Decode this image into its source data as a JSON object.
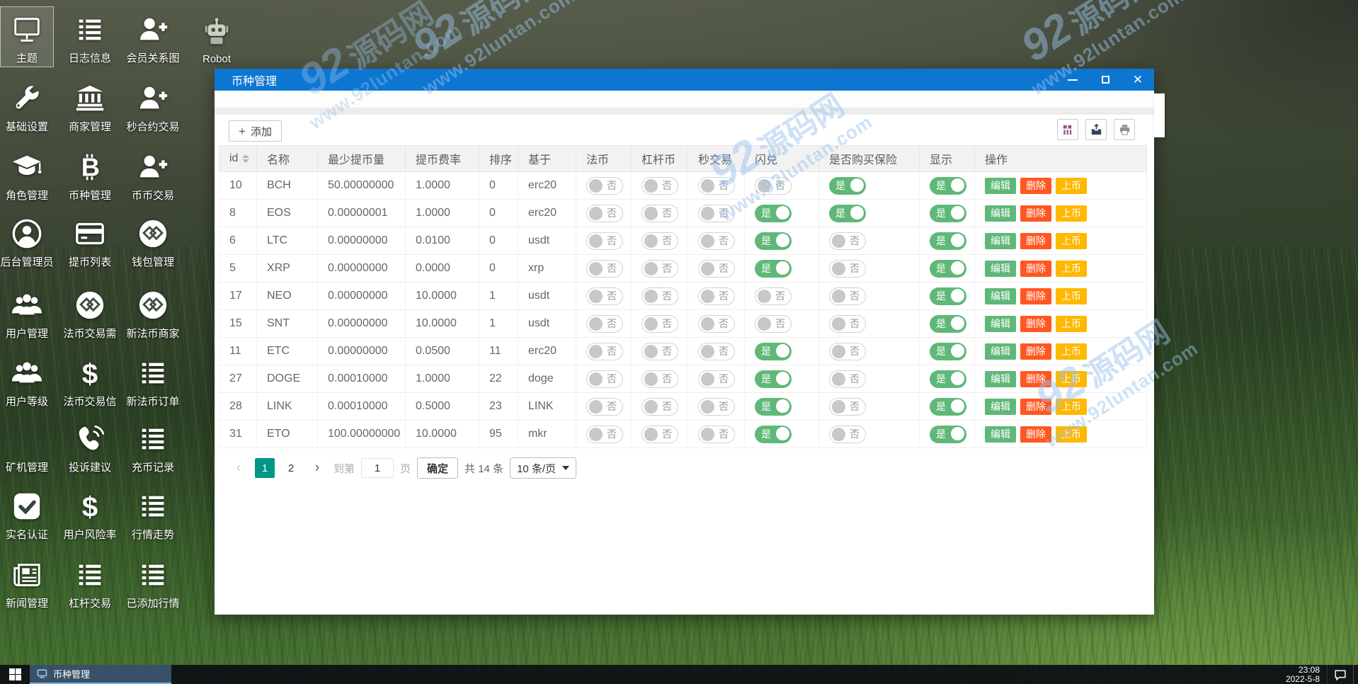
{
  "desktop": {
    "icons": [
      {
        "label": "主题",
        "icon": "monitor-icon",
        "col": 0,
        "row": 0,
        "selected": true
      },
      {
        "label": "日志信息",
        "icon": "list-icon",
        "col": 1,
        "row": 0
      },
      {
        "label": "会员关系图",
        "icon": "user-plus-icon",
        "col": 2,
        "row": 0
      },
      {
        "label": "Robot",
        "icon": "robot-icon",
        "col": 3,
        "row": 0
      },
      {
        "label": "基础设置",
        "icon": "wrench-icon",
        "col": 0,
        "row": 1
      },
      {
        "label": "商家管理",
        "icon": "bank-icon",
        "col": 1,
        "row": 1
      },
      {
        "label": "秒合约交易",
        "icon": "user-plus-icon",
        "col": 2,
        "row": 1
      },
      {
        "label": "角色管理",
        "icon": "graduation-cap-icon",
        "col": 0,
        "row": 2
      },
      {
        "label": "币种管理",
        "icon": "bitcoin-icon",
        "col": 1,
        "row": 2
      },
      {
        "label": "币币交易",
        "icon": "user-plus-icon",
        "col": 2,
        "row": 2
      },
      {
        "label": "后台管理员",
        "icon": "user-circle-icon",
        "col": 0,
        "row": 3
      },
      {
        "label": "提币列表",
        "icon": "credit-card-icon",
        "col": 1,
        "row": 3
      },
      {
        "label": "钱包管理",
        "icon": "gem-circle-icon",
        "col": 2,
        "row": 3
      },
      {
        "label": "用户管理",
        "icon": "users-icon",
        "col": 0,
        "row": 4
      },
      {
        "label": "法币交易需",
        "icon": "gem-circle-icon",
        "col": 1,
        "row": 4
      },
      {
        "label": "新法币商家",
        "icon": "gem-circle-icon",
        "col": 2,
        "row": 4
      },
      {
        "label": "用户等级",
        "icon": "users-icon",
        "col": 0,
        "row": 5
      },
      {
        "label": "法币交易信",
        "icon": "dollar-icon",
        "col": 1,
        "row": 5
      },
      {
        "label": "新法币订单",
        "icon": "list-icon",
        "col": 2,
        "row": 5
      },
      {
        "label": "矿机管理",
        "icon": "none",
        "col": 0,
        "row": 6
      },
      {
        "label": "投诉建议",
        "icon": "phone-icon",
        "col": 1,
        "row": 6
      },
      {
        "label": "充币记录",
        "icon": "list-icon",
        "col": 2,
        "row": 6
      },
      {
        "label": "实名认证",
        "icon": "check-square-icon",
        "col": 0,
        "row": 7
      },
      {
        "label": "用户风险率",
        "icon": "dollar-icon",
        "col": 1,
        "row": 7
      },
      {
        "label": "行情走势",
        "icon": "list-icon",
        "col": 2,
        "row": 7
      },
      {
        "label": "新闻管理",
        "icon": "newspaper-icon",
        "col": 0,
        "row": 8
      },
      {
        "label": "杠杆交易",
        "icon": "list-icon",
        "col": 1,
        "row": 8
      },
      {
        "label": "已添加行情",
        "icon": "list-icon",
        "col": 2,
        "row": 8
      }
    ]
  },
  "window": {
    "title": "币种管理",
    "add_label": "添加",
    "add_plus": "+",
    "table": {
      "headers": [
        "id",
        "名称",
        "最少提币量",
        "提币费率",
        "排序",
        "基于",
        "法币",
        "杠杆币",
        "秒交易",
        "闪兑",
        "是否购买保险",
        "显示",
        "操作"
      ],
      "toggle_on_label": "是",
      "toggle_off_label": "否",
      "actions": [
        "编辑",
        "删除",
        "上币"
      ],
      "rows": [
        {
          "id": "10",
          "name": "BCH",
          "min_withdraw": "50.00000000",
          "fee": "1.0000",
          "sort": "0",
          "base": "erc20",
          "fiat": false,
          "lever": false,
          "seconds": false,
          "flash": false,
          "insurance": true,
          "show": true
        },
        {
          "id": "8",
          "name": "EOS",
          "min_withdraw": "0.00000001",
          "fee": "1.0000",
          "sort": "0",
          "base": "erc20",
          "fiat": false,
          "lever": false,
          "seconds": false,
          "flash": true,
          "insurance": true,
          "show": true
        },
        {
          "id": "6",
          "name": "LTC",
          "min_withdraw": "0.00000000",
          "fee": "0.0100",
          "sort": "0",
          "base": "usdt",
          "fiat": false,
          "lever": false,
          "seconds": false,
          "flash": true,
          "insurance": false,
          "show": true
        },
        {
          "id": "5",
          "name": "XRP",
          "min_withdraw": "0.00000000",
          "fee": "0.0000",
          "sort": "0",
          "base": "xrp",
          "fiat": false,
          "lever": false,
          "seconds": false,
          "flash": true,
          "insurance": false,
          "show": true
        },
        {
          "id": "17",
          "name": "NEO",
          "min_withdraw": "0.00000000",
          "fee": "10.0000",
          "sort": "1",
          "base": "usdt",
          "fiat": false,
          "lever": false,
          "seconds": false,
          "flash": false,
          "insurance": false,
          "show": true
        },
        {
          "id": "15",
          "name": "SNT",
          "min_withdraw": "0.00000000",
          "fee": "10.0000",
          "sort": "1",
          "base": "usdt",
          "fiat": false,
          "lever": false,
          "seconds": false,
          "flash": false,
          "insurance": false,
          "show": true
        },
        {
          "id": "11",
          "name": "ETC",
          "min_withdraw": "0.00000000",
          "fee": "0.0500",
          "sort": "11",
          "base": "erc20",
          "fiat": false,
          "lever": false,
          "seconds": false,
          "flash": true,
          "insurance": false,
          "show": true
        },
        {
          "id": "27",
          "name": "DOGE",
          "min_withdraw": "0.00010000",
          "fee": "1.0000",
          "sort": "22",
          "base": "doge",
          "fiat": false,
          "lever": false,
          "seconds": false,
          "flash": true,
          "insurance": false,
          "show": true
        },
        {
          "id": "28",
          "name": "LINK",
          "min_withdraw": "0.00010000",
          "fee": "0.5000",
          "sort": "23",
          "base": "LINK",
          "fiat": false,
          "lever": false,
          "seconds": false,
          "flash": true,
          "insurance": false,
          "show": true
        },
        {
          "id": "31",
          "name": "ETO",
          "min_withdraw": "100.00000000",
          "fee": "10.0000",
          "sort": "95",
          "base": "mkr",
          "fiat": false,
          "lever": false,
          "seconds": false,
          "flash": true,
          "insurance": false,
          "show": true
        }
      ]
    },
    "pagination": {
      "prev": "‹",
      "pages": [
        "1",
        "2"
      ],
      "active_page": "1",
      "next": "›",
      "goto_label": "到第",
      "goto_value": "1",
      "page_label": "页",
      "confirm_label": "确定",
      "total_label": "共 14 条",
      "per_page_label": "10 条/页"
    }
  },
  "taskbar": {
    "task_label": "币种管理",
    "time": "23:08",
    "date": "2022-5-8"
  },
  "watermark": {
    "logo": "92",
    "name": "源码网",
    "url": "www.92luntan.com"
  },
  "colors": {
    "titlebar_blue": "#0d76d1",
    "toggle_on_green": "#5FB878",
    "edit_green": "#5FB878",
    "delete_red": "#FF5722",
    "listcoin_orange": "#FFB800",
    "active_page_teal": "#009688",
    "header_gray": "#f2f2f2"
  }
}
